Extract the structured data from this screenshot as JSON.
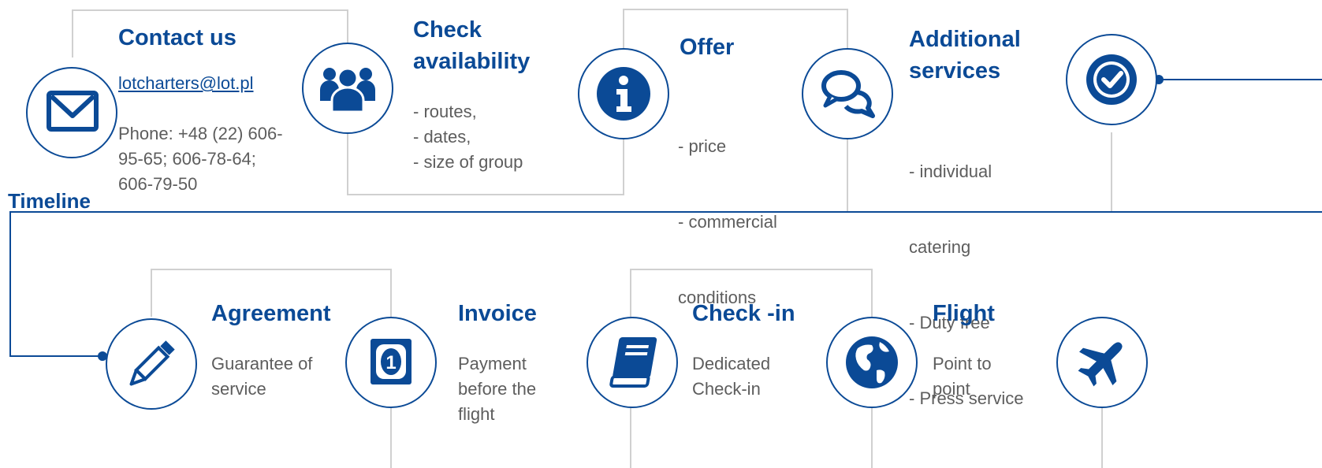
{
  "timeline_label": "Timeline",
  "top_steps": {
    "contact": {
      "title": "Contact us",
      "email": "lotcharters@lot.pl",
      "phone_lines": [
        "Phone: +48 (22) 606-",
        "95-65; 606-78-64;",
        "606-79-50"
      ],
      "icon": "envelope-icon"
    },
    "availability": {
      "title_lines": [
        "Check",
        "availability"
      ],
      "items": [
        "- routes,",
        "- dates,",
        "- size of group"
      ],
      "icon": "group-people-icon"
    },
    "offer": {
      "title": "Offer",
      "items": [
        "-  price",
        "-  commercial",
        "    conditions"
      ],
      "icon": "info-icon"
    },
    "services": {
      "title_lines": [
        "Additional",
        "services"
      ],
      "items": [
        "- individual",
        "  catering",
        "-  Duty free",
        "-  Press service"
      ],
      "icon": "speech-bubbles-icon"
    },
    "confirm": {
      "icon": "check-circle-icon"
    }
  },
  "bottom_steps": {
    "agreement": {
      "title": "Agreement",
      "lines": [
        "Guarantee of",
        "service"
      ],
      "icon": "pencil-icon"
    },
    "invoice": {
      "title": "Invoice",
      "lines": [
        "Payment",
        "before the",
        "flight"
      ],
      "icon": "banknote-icon"
    },
    "checkin": {
      "title": "Check -in",
      "lines": [
        "Dedicated",
        "Check-in"
      ],
      "icon": "book-icon"
    },
    "flight": {
      "title": "Flight",
      "lines": [
        "Point to",
        "point"
      ],
      "icon": "globe-icon"
    },
    "plane": {
      "icon": "airplane-icon"
    }
  },
  "colors": {
    "primary": "#0b4a96",
    "text": "#5d5d5d",
    "connector": "#d0d0d0"
  }
}
